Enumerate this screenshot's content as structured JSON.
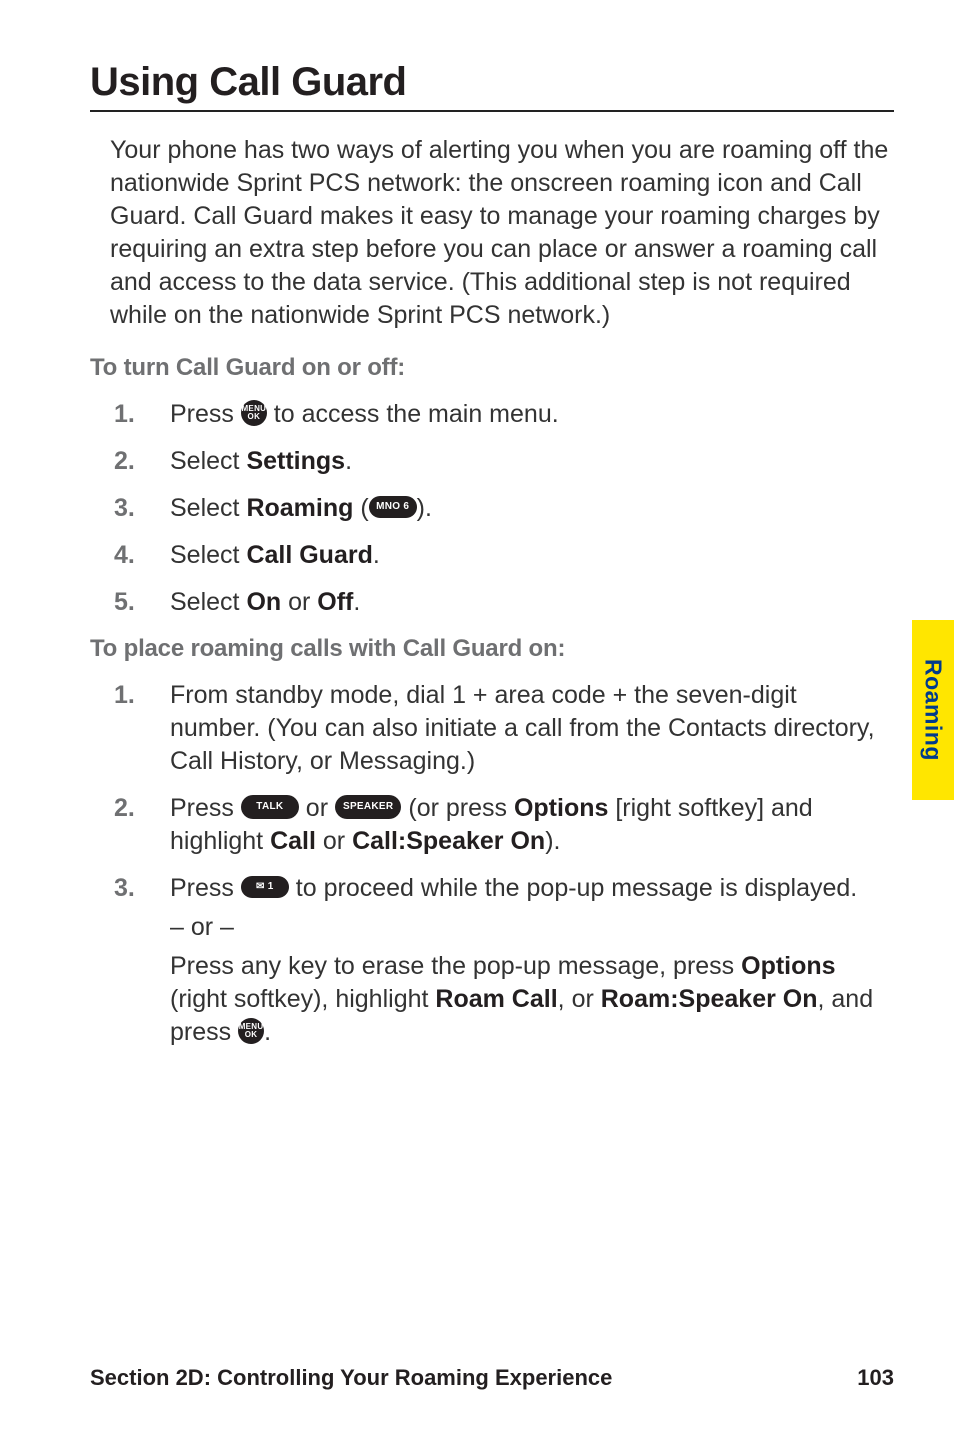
{
  "title": "Using Call Guard",
  "intro": "Your phone has two ways of alerting you when you are roaming off the nationwide Sprint PCS network: the onscreen roaming icon and Call Guard. Call Guard makes it easy to manage your roaming charges by requiring an extra step before you can place or answer a roaming call and access to the data service. (This additional step is not required while on the nationwide Sprint PCS network.)",
  "subhead1": "To turn Call Guard on or off:",
  "steps1": {
    "s1a": "Press ",
    "s1b": " to access the main menu.",
    "s2a": "Select ",
    "s2b": "Settings",
    "s2c": ".",
    "s3a": "Select ",
    "s3b": "Roaming",
    "s3c": " (",
    "s3d": ").",
    "s4a": "Select ",
    "s4b": "Call Guard",
    "s4c": ".",
    "s5a": "Select ",
    "s5b": "On",
    "s5c": " or ",
    "s5d": "Off",
    "s5e": "."
  },
  "subhead2": "To place roaming calls with Call Guard on:",
  "steps2": {
    "s1": "From standby mode, dial 1 + area code + the seven-digit number. (You can also initiate a call from the Contacts directory, Call History, or Messaging.)",
    "s2a": "Press ",
    "s2b": " or ",
    "s2c": " (or press ",
    "s2d": "Options",
    "s2e": " [right softkey] and highlight ",
    "s2f": "Call",
    "s2g": " or ",
    "s2h": "Call:Speaker On",
    "s2i": ").",
    "s3a": "Press ",
    "s3b": " to proceed while the pop-up message is displayed.",
    "s3or": "– or –",
    "s3c": "Press any key to erase the pop-up message, press ",
    "s3d": "Options",
    "s3e": " (right softkey), highlight ",
    "s3f": "Roam Call",
    "s3g": ", or ",
    "s3h": "Roam:Speaker On",
    "s3i": ", and press ",
    "s3j": "."
  },
  "icons": {
    "menu_top": "MENU",
    "menu_bot": "OK",
    "mno6": "MNO 6",
    "talk": "TALK",
    "speaker": "SPEAKER",
    "mail1": "✉ 1"
  },
  "sidebar": "Roaming",
  "footer_left": "Section 2D: Controlling Your Roaming Experience",
  "footer_right": "103"
}
